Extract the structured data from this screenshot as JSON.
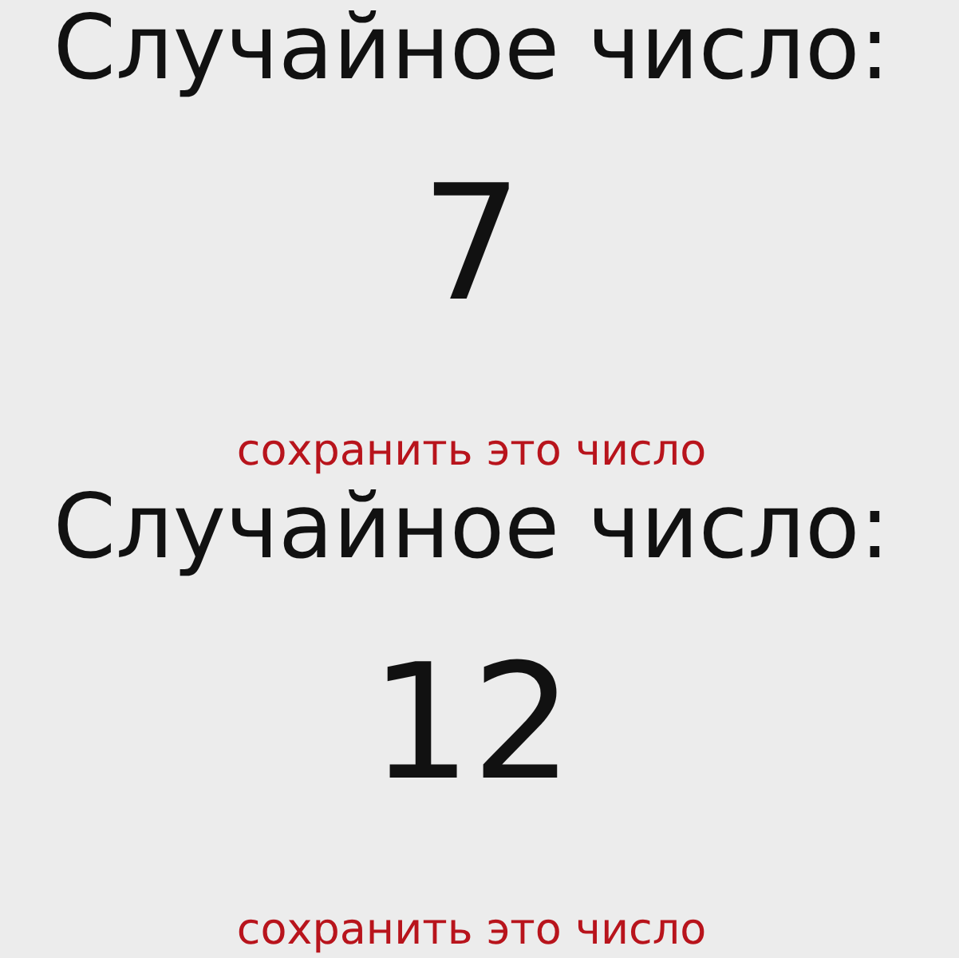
{
  "blocks": [
    {
      "title": "Случайное число:",
      "number": "7",
      "save_link": "сохранить это число"
    },
    {
      "title": "Случайное число:",
      "number": "12",
      "save_link": "сохранить это число"
    }
  ]
}
